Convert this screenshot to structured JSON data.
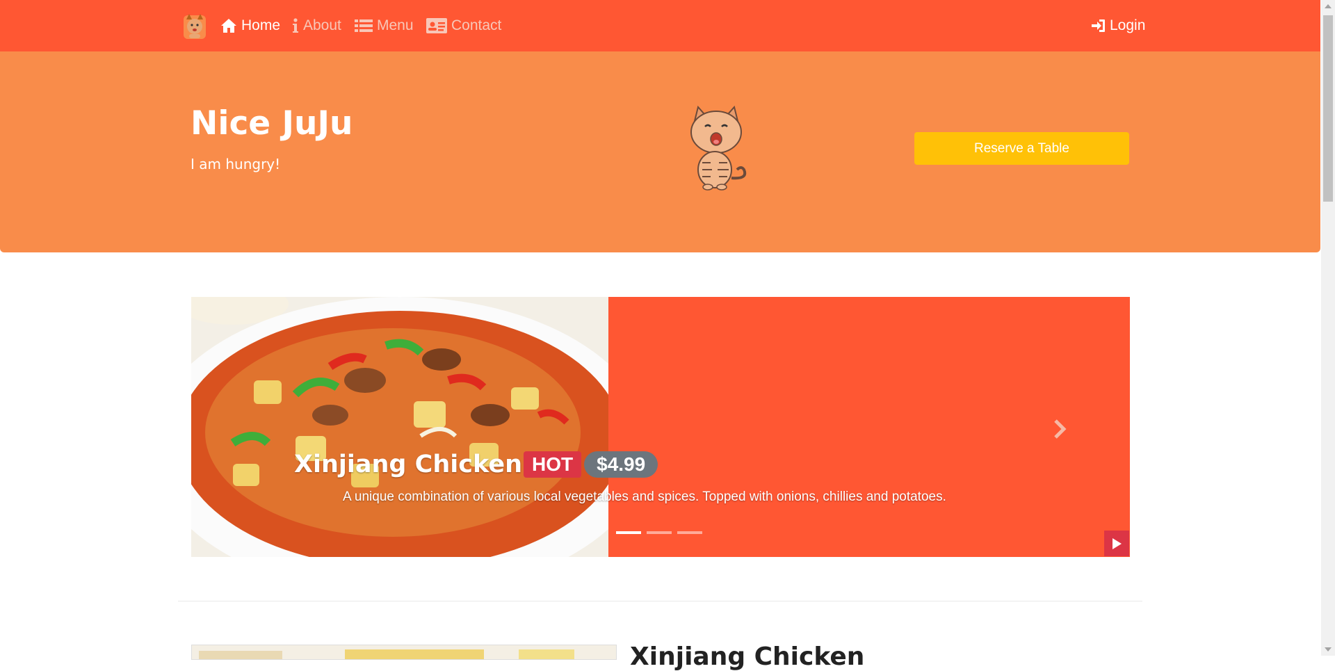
{
  "nav": {
    "home": "Home",
    "about": "About",
    "menu": "Menu",
    "contact": "Contact",
    "login": "Login"
  },
  "hero": {
    "title": "Nice JuJu",
    "subtitle": "I am hungry!",
    "reserve_label": "Reserve a Table"
  },
  "carousel": {
    "title": "Xinjiang Chicken",
    "badge": "HOT",
    "price": "$4.99",
    "description": "A unique combination of various local vegetables and spices. Topped with onions, chillies and potatoes.",
    "active_slide": 1,
    "slide_count": 3
  },
  "section": {
    "dish_title": "Xinjiang Chicken"
  },
  "icons": {
    "home": "home-icon",
    "about": "info-icon",
    "menu": "list-icon",
    "contact": "contact-card-icon",
    "login": "sign-in-icon",
    "next": "chevron-right-icon",
    "play": "play-icon"
  },
  "colors": {
    "navbar": "#ff5733",
    "hero": "#f98c4a",
    "reserve_button": "#ffc107",
    "hot_badge": "#dc3545",
    "price_badge": "#6c757d"
  }
}
